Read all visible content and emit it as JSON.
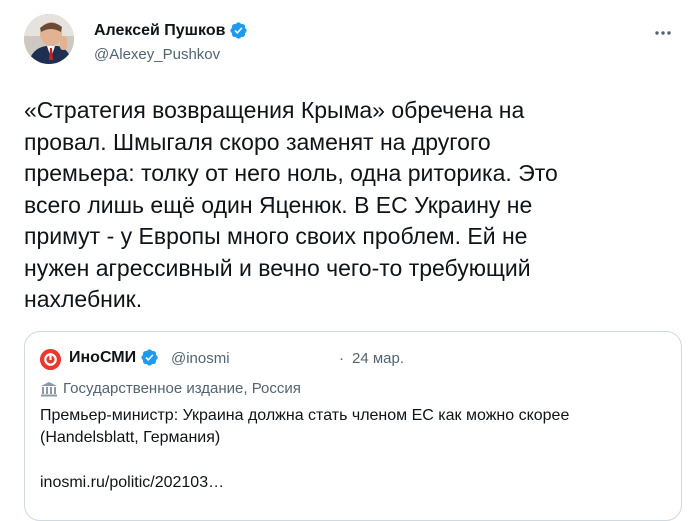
{
  "tweet": {
    "author_name": "Алексей Пушков",
    "handle": "@Alexey_Pushkov",
    "text": "«Стратегия возвращения Крыма» обречена на\nпровал. Шмыгаля скоро заменят на другого\nпремьера: толку от него ноль, одна риторика. Это\nвсего лишь ещё один Яценюк. В ЕС Украину не\nпримут - у Европы много своих проблем. Ей  не\nнужен агрессивный и вечно чего-то требующий\nнахлебник."
  },
  "quoted_tweet": {
    "author_name": "ИноСМИ",
    "handle": "@inosmi",
    "separator": "·",
    "date": "24 мар.",
    "label": "Государственное издание, Россия",
    "text": "Премьер-министр: Украина должна стать членом ЕС как можно скорее (Handelsblatt, Германия)",
    "link": "inosmi.ru/politic/202103…"
  },
  "colors": {
    "text": "#0f1419",
    "secondary": "#536471",
    "verified": "#1d9bf0",
    "border": "#cfd9de",
    "inosmi": "#e8392f"
  },
  "icons": [
    "avatar",
    "verified-badge-icon",
    "more-icon",
    "government-building-icon"
  ]
}
